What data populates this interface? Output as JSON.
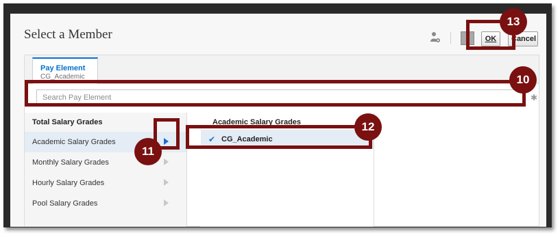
{
  "dialog": {
    "title": "Select a Member",
    "ok_label": "OK",
    "cancel_label": "Cancel",
    "icons": {
      "member_icon": "person-gear-icon"
    }
  },
  "tab": {
    "label": "Pay Element",
    "sublabel": "CG_Academic"
  },
  "search": {
    "placeholder": "Search Pay Element",
    "value": ""
  },
  "left_column": {
    "header": "Total Salary Grades",
    "items": [
      {
        "label": "Academic Salary Grades",
        "selected": true
      },
      {
        "label": "Monthly Salary Grades",
        "selected": false
      },
      {
        "label": "Hourly Salary Grades",
        "selected": false
      },
      {
        "label": "Pool Salary Grades",
        "selected": false
      }
    ]
  },
  "middle_column": {
    "header": "Academic Salary Grades",
    "members": [
      {
        "label": "CG_Academic",
        "checked": true
      }
    ]
  },
  "callouts": {
    "step_10": "10",
    "step_11": "11",
    "step_12": "12",
    "step_13": "13"
  },
  "colors": {
    "callout": "#7a1010",
    "accent": "#0572ce",
    "selection": "#e4ecf5"
  }
}
